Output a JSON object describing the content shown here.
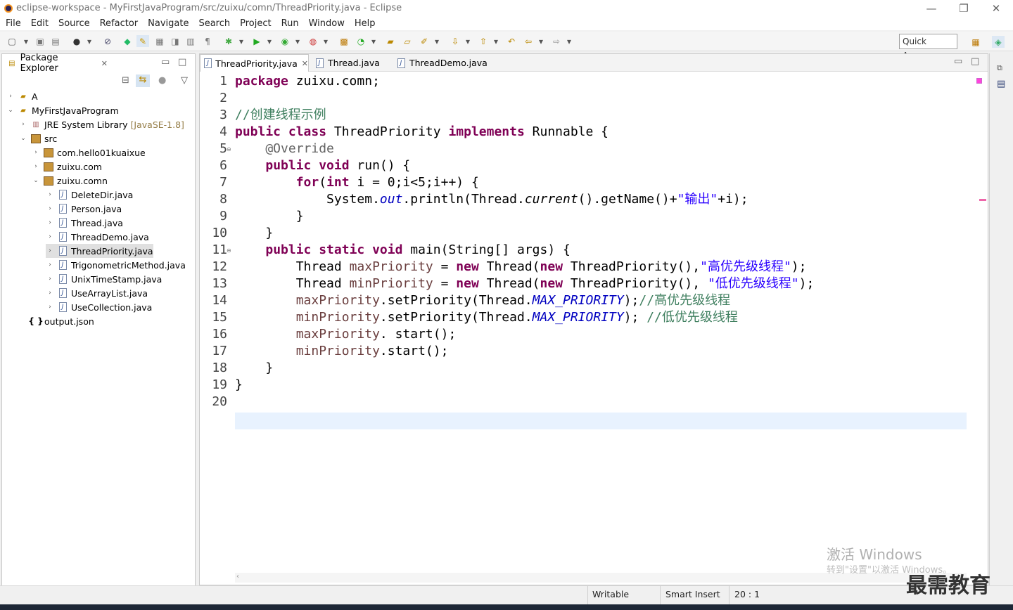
{
  "window": {
    "title": "eclipse-workspace - MyFirstJavaProgram/src/zuixu/comn/ThreadPriority.java - Eclipse"
  },
  "menu": [
    "File",
    "Edit",
    "Source",
    "Refactor",
    "Navigate",
    "Search",
    "Project",
    "Run",
    "Window",
    "Help"
  ],
  "quick_access": "Quick Access",
  "explorer": {
    "title": "Package Explorer",
    "items": [
      {
        "label": "A"
      },
      {
        "label": "MyFirstJavaProgram"
      },
      {
        "label": "JRE System Library",
        "extra": "[JavaSE-1.8]"
      },
      {
        "label": "src"
      },
      {
        "label": "com.hello01kuaixue"
      },
      {
        "label": "zuixu.com"
      },
      {
        "label": "zuixu.comn"
      },
      {
        "label": "DeleteDir.java"
      },
      {
        "label": "Person.java"
      },
      {
        "label": "Thread.java"
      },
      {
        "label": "ThreadDemo.java"
      },
      {
        "label": "ThreadPriority.java"
      },
      {
        "label": "TrigonometricMethod.java"
      },
      {
        "label": "UnixTimeStamp.java"
      },
      {
        "label": "UseArrayList.java"
      },
      {
        "label": "UseCollection.java"
      },
      {
        "label": "output.json"
      }
    ]
  },
  "editor_tabs": [
    "ThreadPriority.java",
    "Thread.java",
    "ThreadDemo.java"
  ],
  "line_numbers": [
    "1",
    "2",
    "3",
    "4",
    "5",
    "6",
    "7",
    "8",
    "9",
    "10",
    "11",
    "12",
    "13",
    "14",
    "15",
    "16",
    "17",
    "18",
    "19",
    "20"
  ],
  "code": {
    "l1_kw": "package",
    "l1_rest": " zuixu.comn;",
    "l3": "//创建线程示例",
    "l4_a": "public class",
    "l4_b": " ThreadPriority ",
    "l4_c": "implements",
    "l4_d": " Runnable {",
    "l5": "    @Override",
    "l6_a": "    ",
    "l6_kw": "public void",
    "l6_rest": " run() {",
    "l7_a": "        ",
    "l7_kw": "for",
    "l7_b": "(",
    "l7_kw2": "int",
    "l7_c": " i = 0;i<5;i++) {",
    "l8_a": "            System.",
    "l8_fld": "out",
    "l8_b": ".println(Thread.",
    "l8_it": "current",
    "l8_c": "().getName()+",
    "l8_st": "\"输出\"",
    "l8_d": "+i);",
    "l9": "        }",
    "l10": "    }",
    "l11_a": "    ",
    "l11_kw": "public static void",
    "l11_rest": " main(String[] args) {",
    "l12_a": "        Thread ",
    "l12_v": "maxPriority",
    "l12_b": " = ",
    "l12_kw": "new",
    "l12_c": " Thread(",
    "l12_kw2": "new",
    "l12_d": " ThreadPriority(),",
    "l12_st": "\"高优先级线程\"",
    "l12_e": ");",
    "l13_a": "        Thread ",
    "l13_v": "minPriority",
    "l13_b": " = ",
    "l13_kw": "new",
    "l13_c": " Thread(",
    "l13_kw2": "new",
    "l13_d": " ThreadPriority(), ",
    "l13_st": "\"低优先级线程\"",
    "l13_e": ");",
    "l14_v": "        maxPriority",
    "l14_b": ".setPriority(Thread.",
    "l14_fld": "MAX_PRIORITY",
    "l14_c": ");",
    "l14_cm": "//高优先级线程",
    "l15_v": "        minPriority",
    "l15_b": ".setPriority(Thread.",
    "l15_fld": "MAX_PRIORITY",
    "l15_c": "); ",
    "l15_cm": "//低优先级线程",
    "l16_v": "        maxPriority",
    "l16_b": ". start();",
    "l17_v": "        minPriority",
    "l17_b": ".start();",
    "l18": "    }",
    "l19": "}"
  },
  "status": {
    "writable": "Writable",
    "insert": "Smart Insert",
    "position": "20 : 1"
  },
  "watermark": {
    "line1": "激活 Windows",
    "line2": "转到\"设置\"以激活 Windows。"
  },
  "brand": "最需教育",
  "colors": {
    "keyword": "#7f0055",
    "comment": "#3f7f5f",
    "string": "#2a00ff",
    "field": "#0000c0",
    "current_line": "#e8f2fe"
  }
}
